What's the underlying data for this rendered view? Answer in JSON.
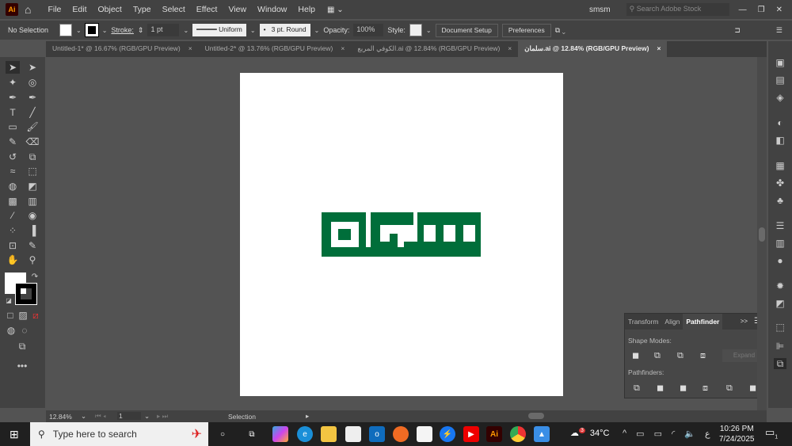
{
  "app": {
    "logo": "Ai"
  },
  "menu": [
    "File",
    "Edit",
    "Object",
    "Type",
    "Select",
    "Effect",
    "View",
    "Window",
    "Help"
  ],
  "workspace": "smsm",
  "search_placeholder": "Search Adobe Stock",
  "control": {
    "selection": "No Selection",
    "stroke_label": "Stroke:",
    "stroke_value": "1 pt",
    "profile": "Uniform",
    "brush": "3 pt. Round",
    "opacity_label": "Opacity:",
    "opacity": "100%",
    "style_label": "Style:",
    "doc_setup": "Document Setup",
    "preferences": "Preferences"
  },
  "tabs": [
    {
      "label": "Untitled-1* @ 16.67% (RGB/GPU Preview)",
      "active": false
    },
    {
      "label": "Untitled-2* @ 13.76% (RGB/GPU Preview)",
      "active": false
    },
    {
      "label": "الكوفي المربع.ai @ 12.84% (RGB/GPU Preview)",
      "active": false
    },
    {
      "label": "سلمان.ai @ 12.84% (RGB/GPU Preview)",
      "active": true
    }
  ],
  "tab_close": "×",
  "logo_color": "#006e3a",
  "panel": {
    "tabs": [
      "Transform",
      "Align",
      "Pathfinder"
    ],
    "shape_modes": "Shape Modes:",
    "expand": "Expand",
    "pathfinders": "Pathfinders:",
    "more": ">>"
  },
  "status": {
    "zoom": "12.84%",
    "artboard": "1",
    "tool": "Selection"
  },
  "taskbar": {
    "search": "Type here to search",
    "temp": "34°C",
    "weather_badge": "3",
    "lang": "ع",
    "time": "10:26 PM",
    "date": "7/24/2025",
    "notif": "1"
  }
}
